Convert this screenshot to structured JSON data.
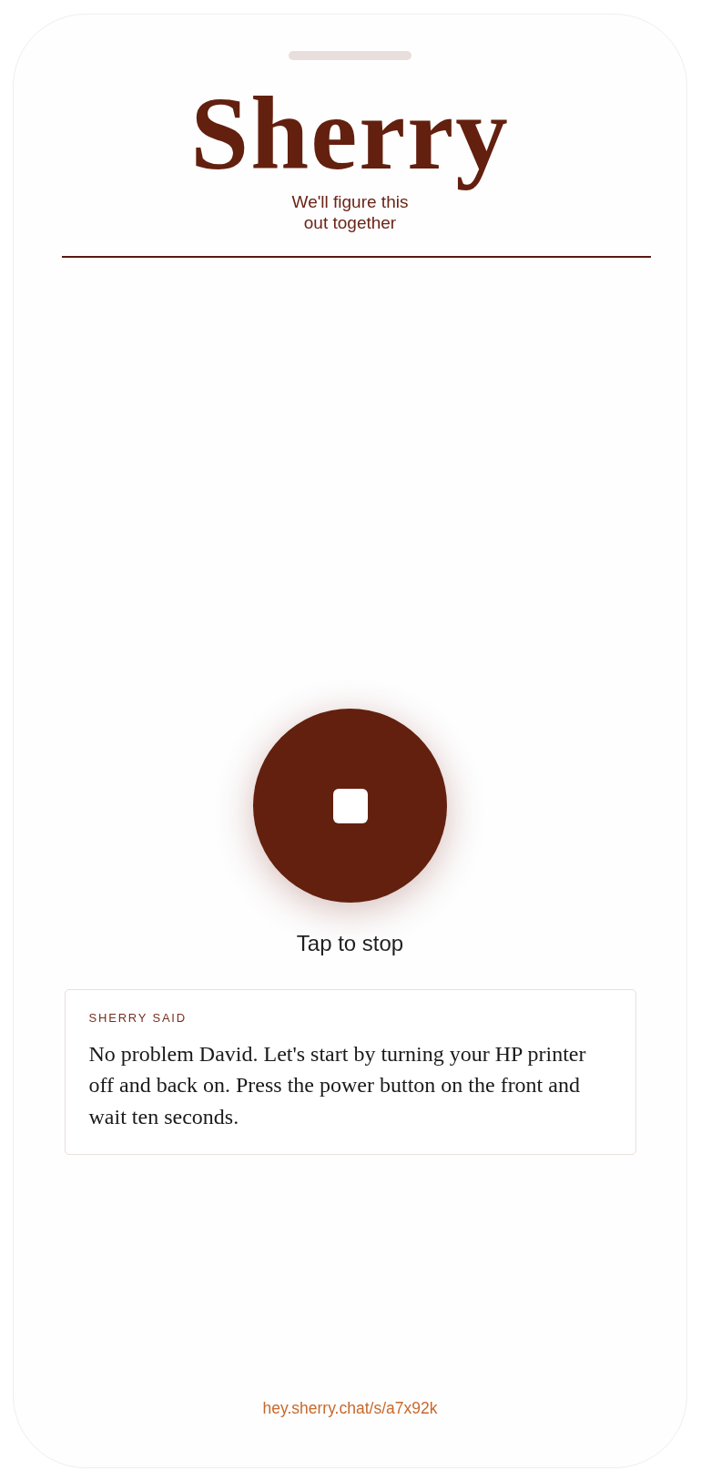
{
  "header": {
    "title": "Sherry",
    "tagline": "We'll figure this out together"
  },
  "record_button": {
    "caption": "Tap to stop"
  },
  "message_card": {
    "label": "SHERRY SAID",
    "text": "No problem David. Let's start by turning your HP printer off and back on. Press the power button on the front and wait ten seconds."
  },
  "footer": {
    "link": "hey.sherry.chat/s/a7x92k"
  }
}
